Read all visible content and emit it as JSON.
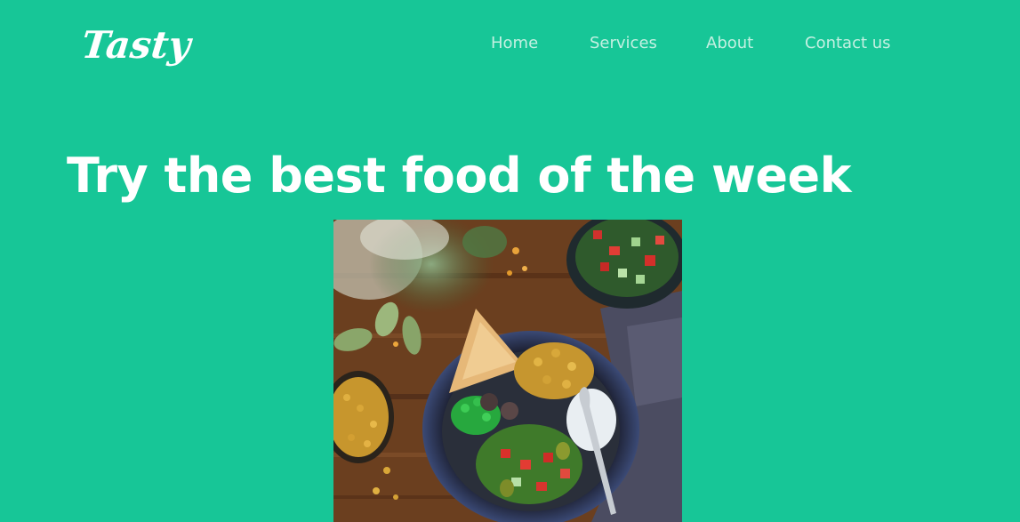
{
  "brand": {
    "logo_text": "Tasty"
  },
  "nav": {
    "items": [
      {
        "label": "Home"
      },
      {
        "label": "Services"
      },
      {
        "label": "About"
      },
      {
        "label": "Contact us"
      }
    ]
  },
  "hero": {
    "headline": "Try the best food of the week",
    "image_subject": "food-bowl-photo"
  },
  "colors": {
    "background": "#17c697",
    "nav_text": "#c4f0e2",
    "headline_text": "#ffffff"
  }
}
